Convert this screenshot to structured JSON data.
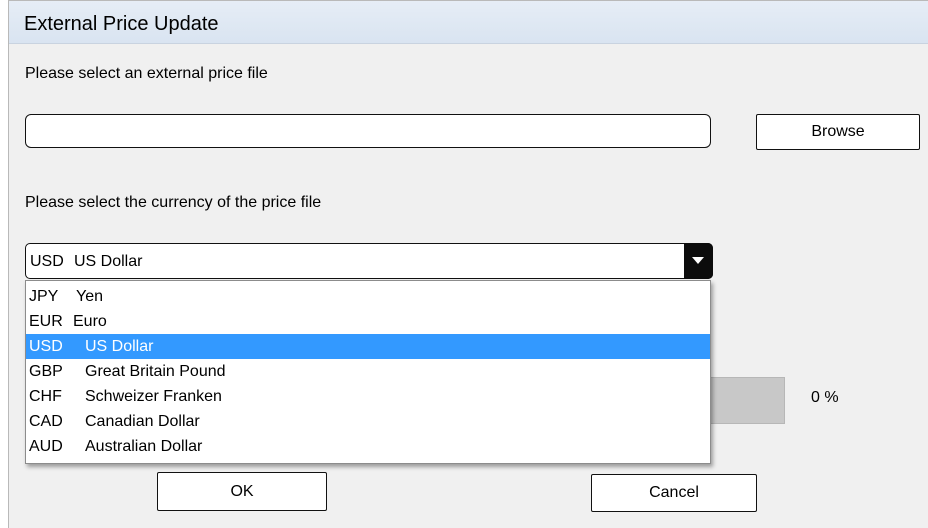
{
  "window": {
    "title": "External Price Update"
  },
  "file_section": {
    "prompt": "Please select an external price file",
    "path_value": "",
    "browse_label": "Browse"
  },
  "currency_section": {
    "prompt": "Please select the currency of the price file",
    "selected": {
      "code": "USD",
      "name": "US Dollar"
    },
    "options": [
      {
        "code": "JPY",
        "name": "Yen"
      },
      {
        "code": "EUR",
        "name": "Euro"
      },
      {
        "code": "USD",
        "name": "US Dollar"
      },
      {
        "code": "GBP",
        "name": "Great Britain Pound"
      },
      {
        "code": "CHF",
        "name": "Schweizer Franken"
      },
      {
        "code": "CAD",
        "name": "Canadian Dollar"
      },
      {
        "code": "AUD",
        "name": "Australian Dollar"
      }
    ],
    "highlighted_index": 2
  },
  "progress": {
    "value": 0,
    "label": "0 %"
  },
  "buttons": {
    "ok_label": "OK",
    "cancel_label": "Cancel"
  },
  "colors": {
    "highlight": "#3399ff",
    "title_bar": "#dde6f2",
    "dialog_bg": "#f0f0f0"
  }
}
